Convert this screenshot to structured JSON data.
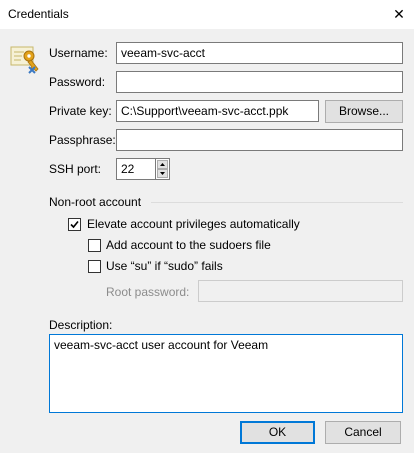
{
  "window": {
    "title": "Credentials"
  },
  "form": {
    "username_label": "Username:",
    "username_value": "veeam-svc-acct",
    "password_label": "Password:",
    "password_value": "",
    "private_key_label": "Private key:",
    "private_key_value": "C:\\Support\\veeam-svc-acct.ppk",
    "browse_label": "Browse...",
    "passphrase_label": "Passphrase:",
    "passphrase_value": "",
    "ssh_port_label": "SSH port:",
    "ssh_port_value": "22"
  },
  "non_root": {
    "group_label": "Non-root account",
    "elevate_label": "Elevate account privileges automatically",
    "elevate_checked": true,
    "sudoers_label": "Add account to the sudoers file",
    "sudoers_checked": false,
    "su_label": "Use “su” if “sudo” fails",
    "su_checked": false,
    "root_password_label": "Root password:",
    "root_password_value": ""
  },
  "description": {
    "label": "Description:",
    "value": "veeam-svc-acct user account for Veeam"
  },
  "footer": {
    "ok_label": "OK",
    "cancel_label": "Cancel"
  },
  "icons": {
    "window_close": "close-icon",
    "credential_key": "key-icon"
  },
  "colors": {
    "accent": "#0078d7",
    "key_gold": "#e3a21a"
  }
}
